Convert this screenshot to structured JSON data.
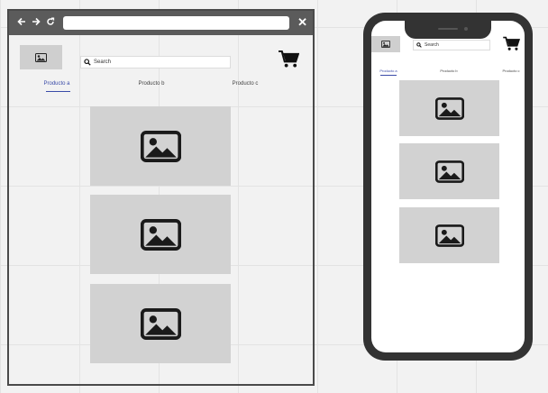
{
  "desktop": {
    "browser": {
      "back_icon": "arrow-left-icon",
      "forward_icon": "arrow-right-icon",
      "reload_icon": "reload-icon",
      "close_label": "✕",
      "url": ""
    },
    "header": {
      "search_placeholder": "Search"
    },
    "tabs": [
      {
        "label": "Producto a",
        "active": true
      },
      {
        "label": "Producto b",
        "active": false
      },
      {
        "label": "Producto c",
        "active": false
      }
    ],
    "products": [
      "image-placeholder",
      "image-placeholder",
      "image-placeholder"
    ]
  },
  "mobile": {
    "header": {
      "search_placeholder": "Search"
    },
    "tabs": [
      {
        "label": "Producto a",
        "active": true
      },
      {
        "label": "Producto b",
        "active": false
      },
      {
        "label": "Producto c",
        "active": false
      }
    ],
    "products": [
      "image-placeholder",
      "image-placeholder",
      "image-placeholder"
    ]
  },
  "colors": {
    "accent": "#3a4ba8",
    "chrome": "#5b5b5b",
    "placeholder": "#d2d2d2",
    "phone_frame": "#333333"
  }
}
